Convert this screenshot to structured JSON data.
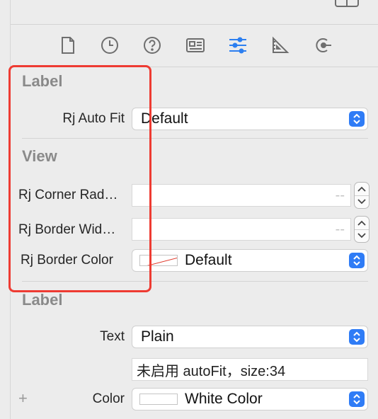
{
  "tabs": [
    {
      "name": "file-inspector-icon"
    },
    {
      "name": "history-inspector-icon"
    },
    {
      "name": "quick-help-icon"
    },
    {
      "name": "identity-inspector-icon"
    },
    {
      "name": "attributes-inspector-icon",
      "active": true
    },
    {
      "name": "size-inspector-icon"
    },
    {
      "name": "connections-inspector-icon"
    }
  ],
  "custom_label_section": {
    "title": "Label",
    "auto_fit_label": "Rj Auto Fit",
    "auto_fit_value": "Default"
  },
  "view_section": {
    "title": "View",
    "corner_radius_label": "Rj Corner Rad…",
    "corner_radius_value": "--",
    "border_width_label": "Rj Border Wid…",
    "border_width_value": "--",
    "border_color_label": "Rj Border Color",
    "border_color_value": "Default"
  },
  "label_section": {
    "title": "Label",
    "text_label": "Text",
    "text_type": "Plain",
    "text_value": "未启用 autoFit，size:34",
    "color_label": "Color",
    "color_value": "White Color",
    "add_symbol": "+"
  },
  "colors": {
    "accent": "#2f7cf6",
    "highlight_border": "#ee3b32",
    "panel_bg": "#ececec"
  }
}
